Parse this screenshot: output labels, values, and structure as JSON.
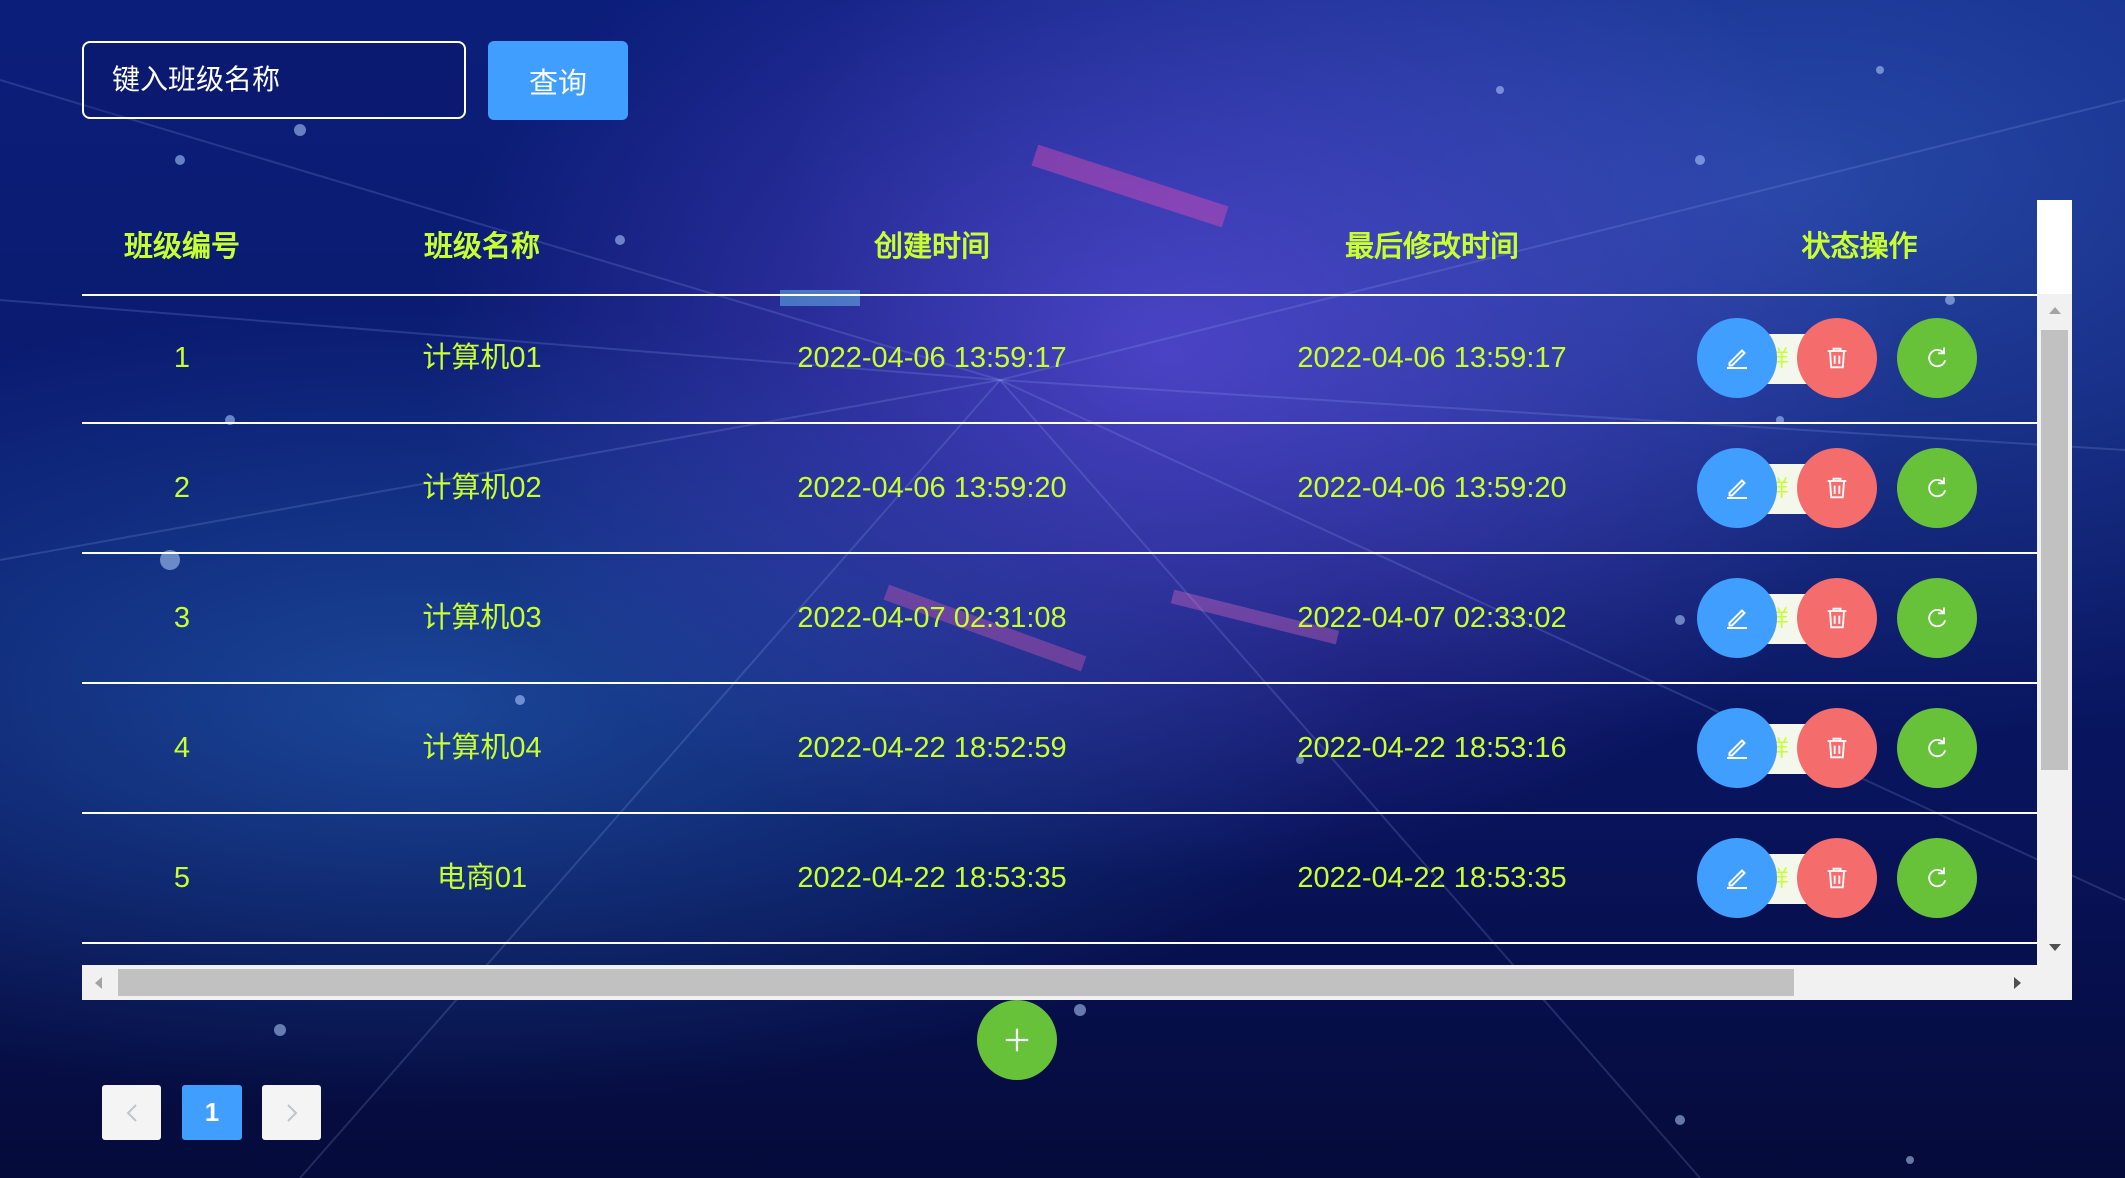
{
  "search": {
    "placeholder": "键入班级名称",
    "value": "",
    "button_label": "查询"
  },
  "table": {
    "columns": [
      "班级编号",
      "班级名称",
      "创建时间",
      "最后修改时间",
      "状态操作"
    ],
    "rows": [
      {
        "id": "1",
        "name": "计算机01",
        "created": "2022-04-06 13:59:17",
        "modified": "2022-04-06 13:59:17"
      },
      {
        "id": "2",
        "name": "计算机02",
        "created": "2022-04-06 13:59:20",
        "modified": "2022-04-06 13:59:20"
      },
      {
        "id": "3",
        "name": "计算机03",
        "created": "2022-04-07 02:31:08",
        "modified": "2022-04-07 02:33:02"
      },
      {
        "id": "4",
        "name": "计算机04",
        "created": "2022-04-22 18:52:59",
        "modified": "2022-04-22 18:53:16"
      },
      {
        "id": "5",
        "name": "电商01",
        "created": "2022-04-22 18:53:35",
        "modified": "2022-04-22 18:53:35"
      }
    ],
    "row_actions": {
      "detail_label": "详",
      "edit_icon": "edit-icon",
      "delete_icon": "trash-icon",
      "reset_icon": "refresh-icon"
    }
  },
  "add_button": {
    "icon": "plus-icon"
  },
  "pagination": {
    "current_page": "1",
    "prev_icon": "chevron-left-icon",
    "next_icon": "chevron-right-icon"
  },
  "colors": {
    "text_accent": "#c8ff2e",
    "primary": "#409eff",
    "danger": "#f56c6c",
    "success": "#67c23a"
  }
}
